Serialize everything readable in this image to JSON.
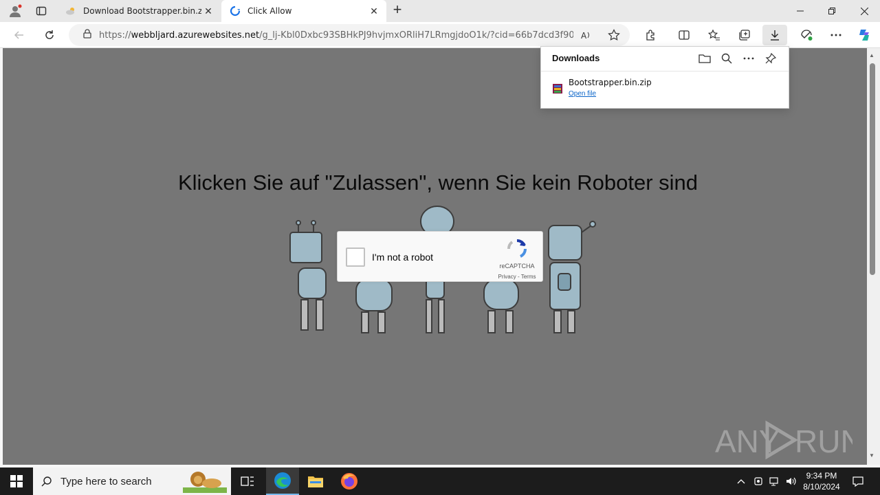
{
  "browser": {
    "tabs": [
      {
        "title": "Download Bootstrapper.bin.zip fi",
        "active": false
      },
      {
        "title": "Click Allow",
        "active": true
      }
    ],
    "new_tab_label": "+",
    "url_prefix": "https://",
    "url_host": "webbljard.azurewebsites.net",
    "url_path": "/g_lj-Kbl0Dxbc93SBHkPJ9hvjmxORliH7LRmgjdoO1k/?cid=66b7dcd3f9077c..."
  },
  "page": {
    "headline": "Klicken Sie auf \"Zulassen\", wenn Sie kein Roboter sind",
    "captcha": {
      "label": "I'm not a robot",
      "brand": "reCAPTCHA",
      "terms": "Privacy - Terms"
    },
    "watermark": "ANY RUN"
  },
  "downloads": {
    "title": "Downloads",
    "item": {
      "name": "Bootstrapper.bin.zip",
      "action": "Open file"
    }
  },
  "taskbar": {
    "search_placeholder": "Type here to search",
    "time": "9:34 PM",
    "date": "8/10/2024"
  },
  "colors": {
    "page_bg": "#767676",
    "link": "#0a64c8",
    "taskbar": "#1c1c1c"
  }
}
